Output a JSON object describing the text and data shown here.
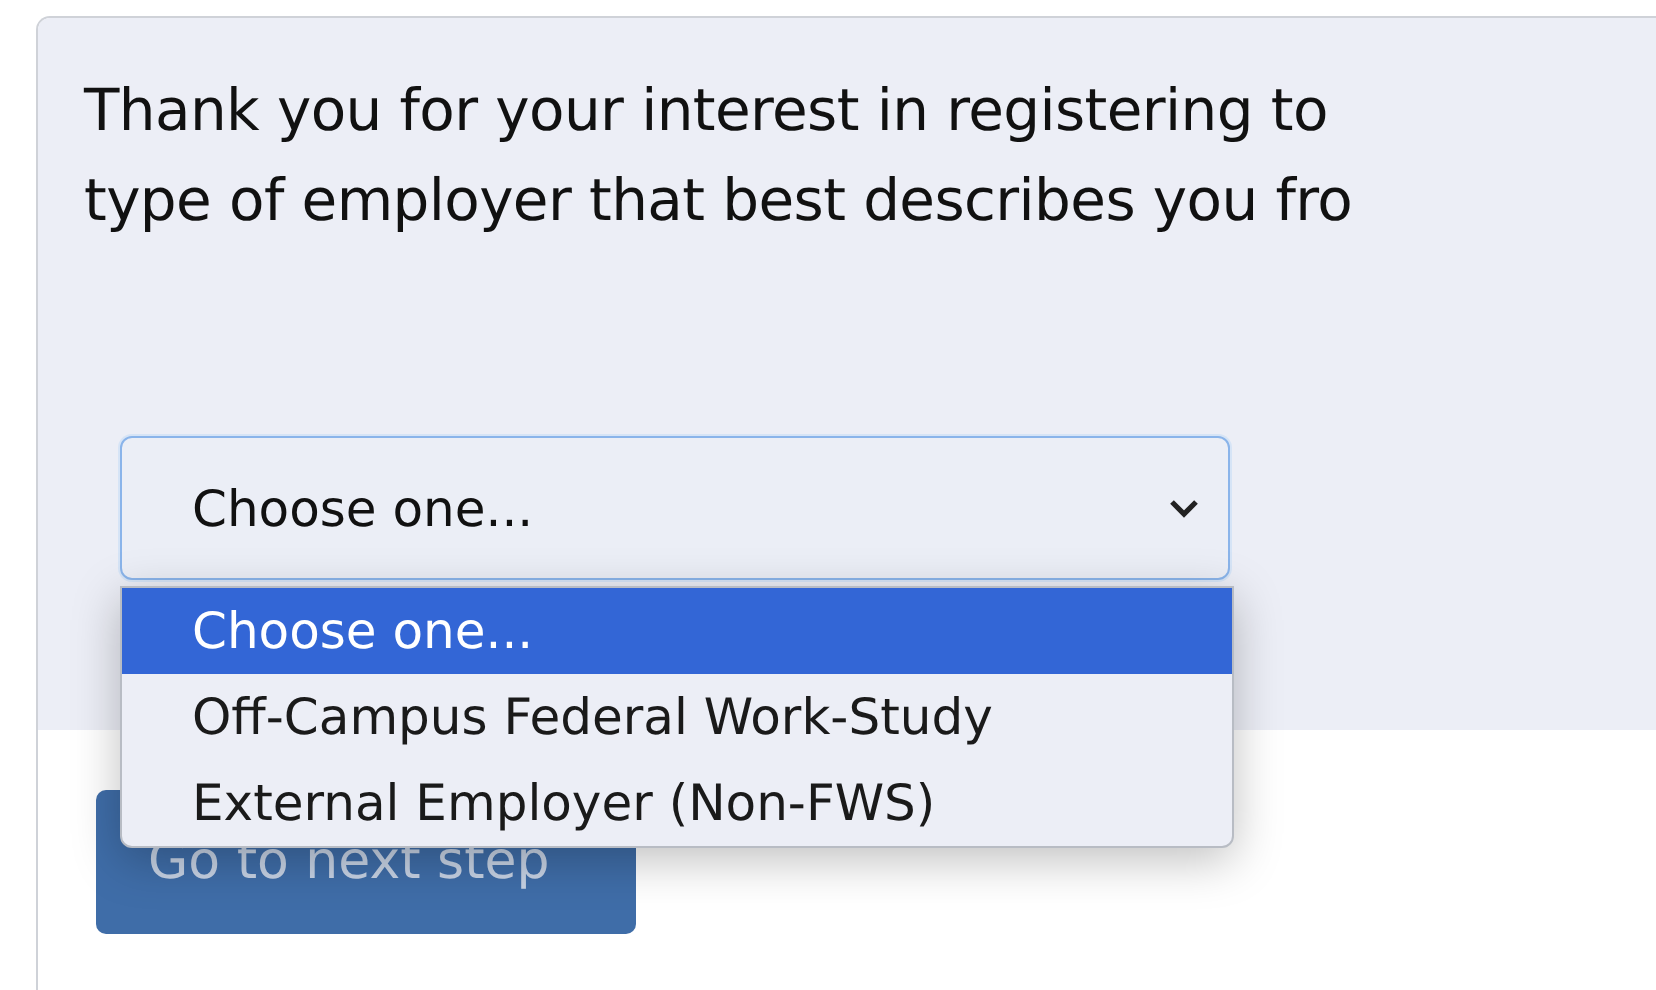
{
  "intro": {
    "lines": [
      "Thank you for your interest in registering to",
      "type of employer that best describes you fro"
    ]
  },
  "select": {
    "value": "Choose one...",
    "expanded": true,
    "options": [
      {
        "label": "Choose one...",
        "selected": true
      },
      {
        "label": "Off-Campus Federal Work-Study",
        "selected": false
      },
      {
        "label": "External Employer (Non-FWS)",
        "selected": false
      }
    ]
  },
  "button": {
    "label": "Go to next step",
    "disabled": true
  }
}
